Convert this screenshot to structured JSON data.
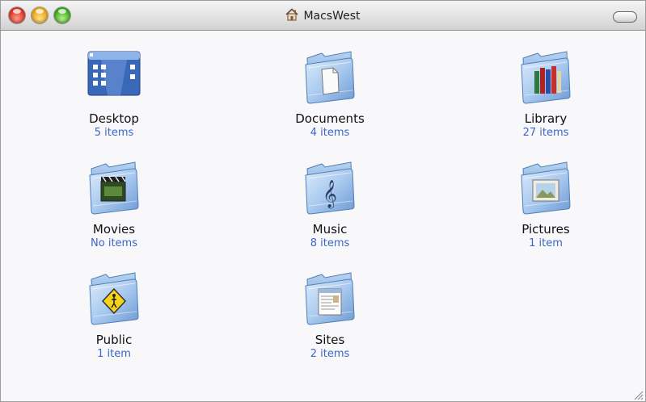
{
  "window": {
    "title": "MacsWest",
    "title_icon": "home-icon"
  },
  "items": [
    {
      "name": "Desktop",
      "count": "5 items",
      "icon": "desktop-icon"
    },
    {
      "name": "Documents",
      "count": "4 items",
      "icon": "documents-folder-icon"
    },
    {
      "name": "Library",
      "count": "27 items",
      "icon": "library-folder-icon"
    },
    {
      "name": "Movies",
      "count": "No items",
      "icon": "movies-folder-icon"
    },
    {
      "name": "Music",
      "count": "8 items",
      "icon": "music-folder-icon"
    },
    {
      "name": "Pictures",
      "count": "1 item",
      "icon": "pictures-folder-icon"
    },
    {
      "name": "Public",
      "count": "1 item",
      "icon": "public-folder-icon"
    },
    {
      "name": "Sites",
      "count": "2 items",
      "icon": "sites-folder-icon"
    }
  ],
  "colors": {
    "count_text": "#3a66c8",
    "folder_blue": "#8fb8e8"
  }
}
